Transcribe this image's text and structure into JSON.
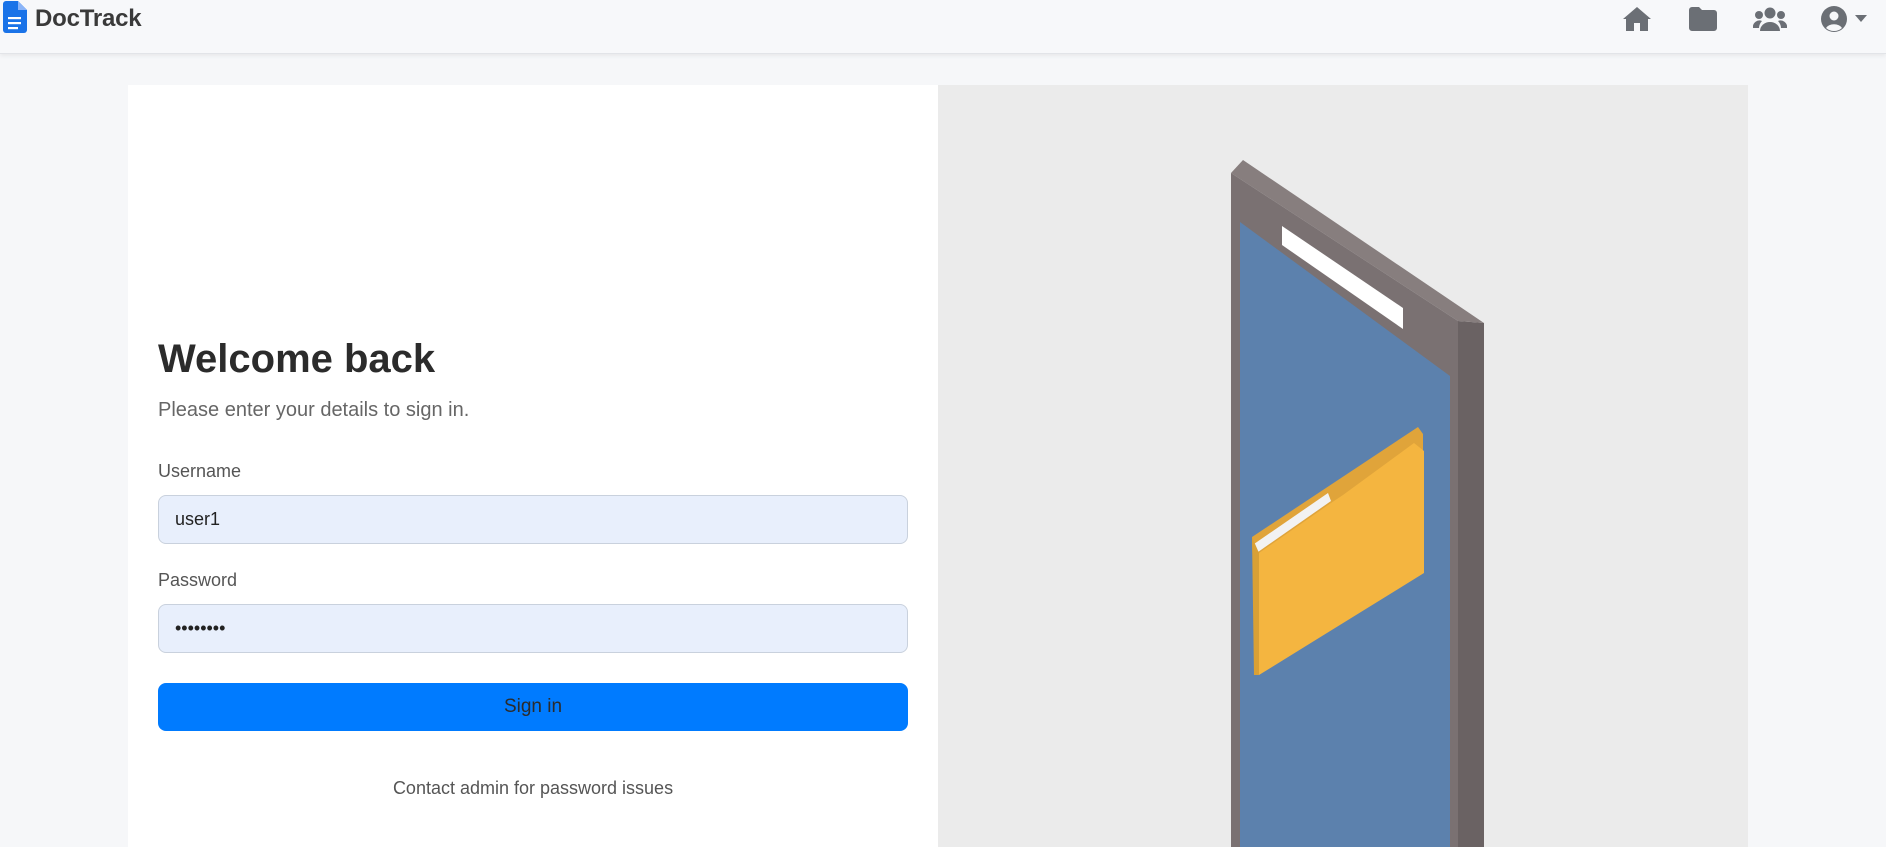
{
  "app": {
    "brand": "DocTrack",
    "brand_icon": "document-icon",
    "accent_color": "#007bff"
  },
  "nav": {
    "icons": [
      "home-icon",
      "folder-icon",
      "users-icon",
      "user-circle-icon",
      "caret-down-icon"
    ]
  },
  "login": {
    "title": "Welcome back",
    "subtitle": "Please enter your details to sign in.",
    "username_label": "Username",
    "username_value": "user1",
    "password_label": "Password",
    "password_value": "password",
    "submit_label": "Sign in",
    "contact_text": "Contact admin for password issues"
  },
  "illustration": {
    "description_icon": "phone-with-folder-illustration"
  }
}
